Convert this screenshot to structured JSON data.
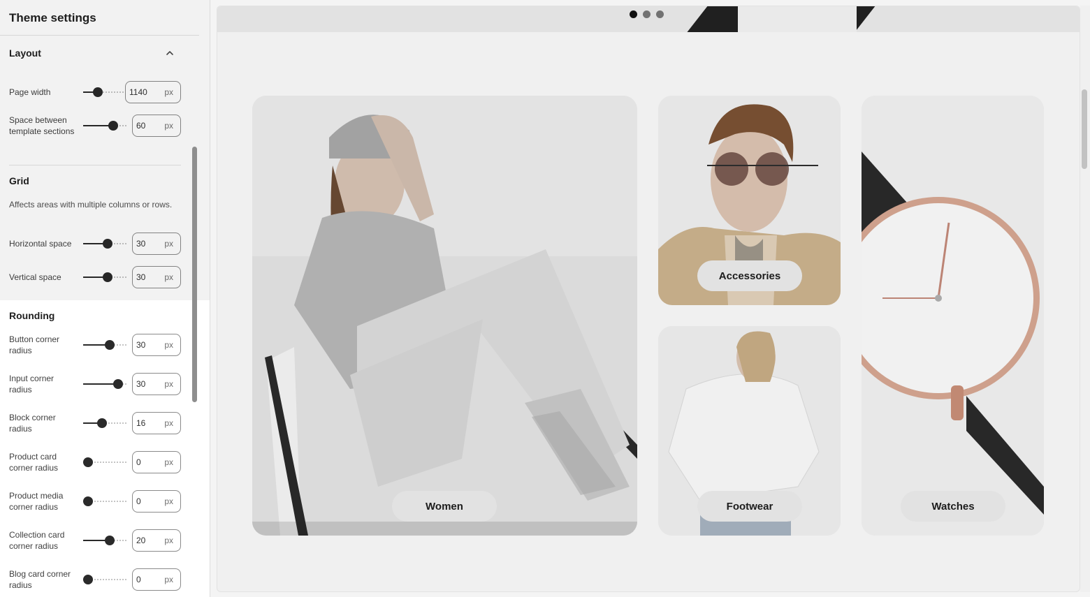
{
  "sidebar": {
    "title": "Theme settings",
    "layout": {
      "heading": "Layout",
      "settings": [
        {
          "label": "Page width",
          "value": "1140",
          "unit": "px",
          "level": 0.22
        },
        {
          "label": "Space between template sections",
          "value": "60",
          "unit": "px",
          "level": 0.58
        }
      ]
    },
    "grid": {
      "heading": "Grid",
      "description": "Affects areas with multiple columns or rows.",
      "settings": [
        {
          "label": "Horizontal space",
          "value": "30",
          "unit": "px",
          "level": 0.45
        },
        {
          "label": "Vertical space",
          "value": "30",
          "unit": "px",
          "level": 0.45
        }
      ]
    },
    "rounding": {
      "heading": "Rounding",
      "settings": [
        {
          "label": "Button corner radius",
          "value": "30",
          "unit": "px",
          "level": 0.5
        },
        {
          "label": "Input corner radius",
          "value": "30",
          "unit": "px",
          "level": 0.7
        },
        {
          "label": "Block corner radius",
          "value": "16",
          "unit": "px",
          "level": 0.32
        },
        {
          "label": "Product card corner radius",
          "value": "0",
          "unit": "px",
          "level": 0.0
        },
        {
          "label": "Product media corner radius",
          "value": "0",
          "unit": "px",
          "level": 0.0
        },
        {
          "label": "Collection card corner radius",
          "value": "20",
          "unit": "px",
          "level": 0.5
        },
        {
          "label": "Blog card corner radius",
          "value": "0",
          "unit": "px",
          "level": 0.0
        }
      ]
    }
  },
  "preview": {
    "slideshow": {
      "dots": 3,
      "active_index": 0
    },
    "collections": [
      {
        "label": "Women"
      },
      {
        "label": "Accessories"
      },
      {
        "label": "Footwear"
      },
      {
        "label": "Watches"
      }
    ]
  },
  "colors": {
    "accent": "#2a2a2a",
    "highlight_panel": "#ffffff"
  }
}
